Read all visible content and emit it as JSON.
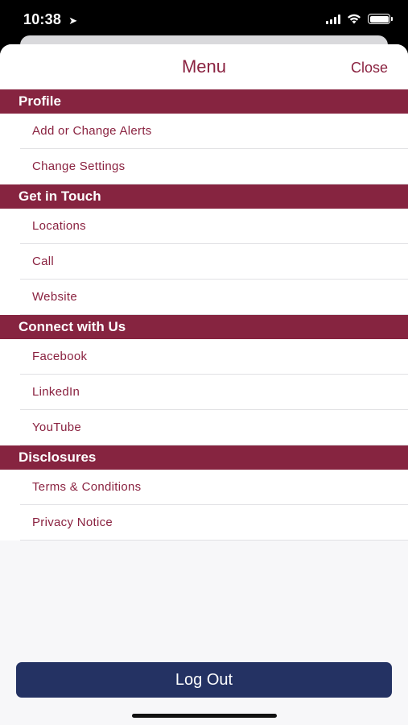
{
  "status_bar": {
    "time": "10:38",
    "location_icon": "location-arrow-icon",
    "signal_icon": "cellular-signal-icon",
    "wifi_icon": "wifi-icon",
    "battery_icon": "battery-icon"
  },
  "header": {
    "title": "Menu",
    "close_label": "Close"
  },
  "sections": [
    {
      "title": "Profile",
      "items": [
        "Add or Change Alerts",
        "Change Settings"
      ]
    },
    {
      "title": "Get in Touch",
      "items": [
        "Locations",
        "Call",
        "Website"
      ]
    },
    {
      "title": "Connect with Us",
      "items": [
        "Facebook",
        "LinkedIn",
        "YouTube"
      ]
    },
    {
      "title": "Disclosures",
      "items": [
        "Terms & Conditions",
        "Privacy Notice"
      ]
    }
  ],
  "logout_label": "Log Out",
  "colors": {
    "accent": "#862440",
    "logout": "#243263"
  }
}
